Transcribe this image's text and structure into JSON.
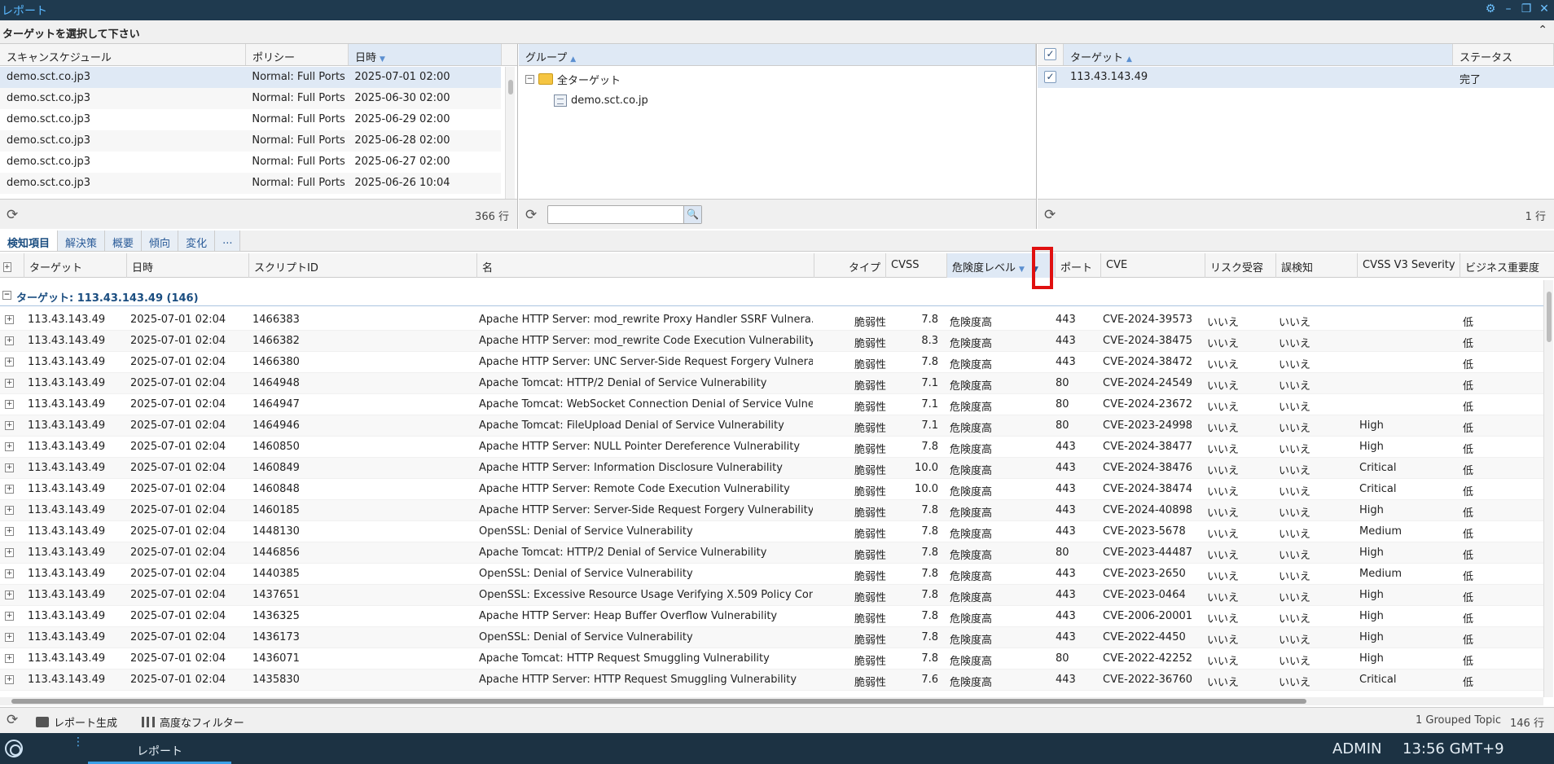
{
  "window": {
    "title": "レポート"
  },
  "select_bar": {
    "label": "ターゲットを選択して下さい"
  },
  "schedule_pane": {
    "headers": [
      "スキャンスケジュール",
      "ポリシー",
      "日時"
    ],
    "rows": [
      [
        "demo.sct.co.jp3",
        "Normal: Full Ports",
        "2025-07-01 02:00"
      ],
      [
        "demo.sct.co.jp3",
        "Normal: Full Ports",
        "2025-06-30 02:00"
      ],
      [
        "demo.sct.co.jp3",
        "Normal: Full Ports",
        "2025-06-29 02:00"
      ],
      [
        "demo.sct.co.jp3",
        "Normal: Full Ports",
        "2025-06-28 02:00"
      ],
      [
        "demo.sct.co.jp3",
        "Normal: Full Ports",
        "2025-06-27 02:00"
      ],
      [
        "demo.sct.co.jp3",
        "Normal: Full Ports",
        "2025-06-26 10:04"
      ]
    ],
    "count": "366 行"
  },
  "group_pane": {
    "header": "グループ",
    "root": "全ターゲット",
    "child": "demo.sct.co.jp"
  },
  "target_pane": {
    "headers": [
      "ターゲット",
      "ステータス"
    ],
    "rows": [
      [
        "113.43.143.49",
        "完了"
      ]
    ],
    "count": "1 行"
  },
  "tabs": [
    "検知項目",
    "解決策",
    "概要",
    "傾向",
    "変化",
    "..."
  ],
  "grid": {
    "headers": [
      "ターゲット",
      "日時",
      "スクリプトID",
      "名",
      "タイプ",
      "CVSS",
      "危険度レベル",
      "ポート",
      "CVE",
      "リスク受容",
      "誤検知",
      "CVSS V3 Severity",
      "ビジネス重要度"
    ],
    "group_label": "ターゲット: 113.43.143.49 (146)",
    "rows": [
      [
        "113.43.143.49",
        "2025-07-01 02:04",
        "1466383",
        "Apache HTTP Server: mod_rewrite Proxy Handler SSRF Vulnera...",
        "脆弱性",
        "7.8",
        "危険度高",
        "443",
        "CVE-2024-39573",
        "いいえ",
        "いいえ",
        "",
        "低"
      ],
      [
        "113.43.143.49",
        "2025-07-01 02:04",
        "1466382",
        "Apache HTTP Server: mod_rewrite Code Execution Vulnerability",
        "脆弱性",
        "8.3",
        "危険度高",
        "443",
        "CVE-2024-38475",
        "いいえ",
        "いいえ",
        "",
        "低"
      ],
      [
        "113.43.143.49",
        "2025-07-01 02:04",
        "1466380",
        "Apache HTTP Server: UNC Server-Side Request Forgery Vulnera...",
        "脆弱性",
        "7.8",
        "危険度高",
        "443",
        "CVE-2024-38472",
        "いいえ",
        "いいえ",
        "",
        "低"
      ],
      [
        "113.43.143.49",
        "2025-07-01 02:04",
        "1464948",
        "Apache Tomcat: HTTP/2 Denial of Service Vulnerability",
        "脆弱性",
        "7.1",
        "危険度高",
        "80",
        "CVE-2024-24549",
        "いいえ",
        "いいえ",
        "",
        "低"
      ],
      [
        "113.43.143.49",
        "2025-07-01 02:04",
        "1464947",
        "Apache Tomcat: WebSocket Connection Denial of Service Vulne...",
        "脆弱性",
        "7.1",
        "危険度高",
        "80",
        "CVE-2024-23672",
        "いいえ",
        "いいえ",
        "",
        "低"
      ],
      [
        "113.43.143.49",
        "2025-07-01 02:04",
        "1464946",
        "Apache Tomcat: FileUpload Denial of Service Vulnerability",
        "脆弱性",
        "7.1",
        "危険度高",
        "80",
        "CVE-2023-24998",
        "いいえ",
        "いいえ",
        "High",
        "低"
      ],
      [
        "113.43.143.49",
        "2025-07-01 02:04",
        "1460850",
        "Apache HTTP Server: NULL Pointer Dereference Vulnerability",
        "脆弱性",
        "7.8",
        "危険度高",
        "443",
        "CVE-2024-38477",
        "いいえ",
        "いいえ",
        "High",
        "低"
      ],
      [
        "113.43.143.49",
        "2025-07-01 02:04",
        "1460849",
        "Apache HTTP Server: Information Disclosure Vulnerability",
        "脆弱性",
        "10.0",
        "危険度高",
        "443",
        "CVE-2024-38476",
        "いいえ",
        "いいえ",
        "Critical",
        "低"
      ],
      [
        "113.43.143.49",
        "2025-07-01 02:04",
        "1460848",
        "Apache HTTP Server: Remote Code Execution Vulnerability",
        "脆弱性",
        "10.0",
        "危険度高",
        "443",
        "CVE-2024-38474",
        "いいえ",
        "いいえ",
        "Critical",
        "低"
      ],
      [
        "113.43.143.49",
        "2025-07-01 02:04",
        "1460185",
        "Apache HTTP Server: Server-Side Request Forgery Vulnerability",
        "脆弱性",
        "7.8",
        "危険度高",
        "443",
        "CVE-2024-40898",
        "いいえ",
        "いいえ",
        "High",
        "低"
      ],
      [
        "113.43.143.49",
        "2025-07-01 02:04",
        "1448130",
        "OpenSSL: Denial of Service Vulnerability",
        "脆弱性",
        "7.8",
        "危険度高",
        "443",
        "CVE-2023-5678",
        "いいえ",
        "いいえ",
        "Medium",
        "低"
      ],
      [
        "113.43.143.49",
        "2025-07-01 02:04",
        "1446856",
        "Apache Tomcat: HTTP/2 Denial of Service Vulnerability",
        "脆弱性",
        "7.8",
        "危険度高",
        "80",
        "CVE-2023-44487",
        "いいえ",
        "いいえ",
        "High",
        "低"
      ],
      [
        "113.43.143.49",
        "2025-07-01 02:04",
        "1440385",
        "OpenSSL: Denial of Service Vulnerability",
        "脆弱性",
        "7.8",
        "危険度高",
        "443",
        "CVE-2023-2650",
        "いいえ",
        "いいえ",
        "Medium",
        "低"
      ],
      [
        "113.43.143.49",
        "2025-07-01 02:04",
        "1437651",
        "OpenSSL: Excessive Resource Usage Verifying X.509 Policy Con...",
        "脆弱性",
        "7.8",
        "危険度高",
        "443",
        "CVE-2023-0464",
        "いいえ",
        "いいえ",
        "High",
        "低"
      ],
      [
        "113.43.143.49",
        "2025-07-01 02:04",
        "1436325",
        "Apache HTTP Server: Heap Buffer Overflow Vulnerability",
        "脆弱性",
        "7.8",
        "危険度高",
        "443",
        "CVE-2006-20001",
        "いいえ",
        "いいえ",
        "High",
        "低"
      ],
      [
        "113.43.143.49",
        "2025-07-01 02:04",
        "1436173",
        "OpenSSL: Denial of Service Vulnerability",
        "脆弱性",
        "7.8",
        "危険度高",
        "443",
        "CVE-2022-4450",
        "いいえ",
        "いいえ",
        "High",
        "低"
      ],
      [
        "113.43.143.49",
        "2025-07-01 02:04",
        "1436071",
        "Apache Tomcat: HTTP Request Smuggling Vulnerability",
        "脆弱性",
        "7.8",
        "危険度高",
        "80",
        "CVE-2022-42252",
        "いいえ",
        "いいえ",
        "High",
        "低"
      ],
      [
        "113.43.143.49",
        "2025-07-01 02:04",
        "1435830",
        "Apache HTTP Server: HTTP Request Smuggling Vulnerability",
        "脆弱性",
        "7.6",
        "危険度高",
        "443",
        "CVE-2022-36760",
        "いいえ",
        "いいえ",
        "Critical",
        "低"
      ]
    ]
  },
  "toolbar": {
    "report_label": "レポート生成",
    "filter_label": "高度なフィルター",
    "grouped": "1 Grouped Topic",
    "count": "146 行"
  },
  "taskbar": {
    "tab_label": "レポート",
    "user": "ADMIN",
    "clock": "13:56 GMT+9"
  }
}
